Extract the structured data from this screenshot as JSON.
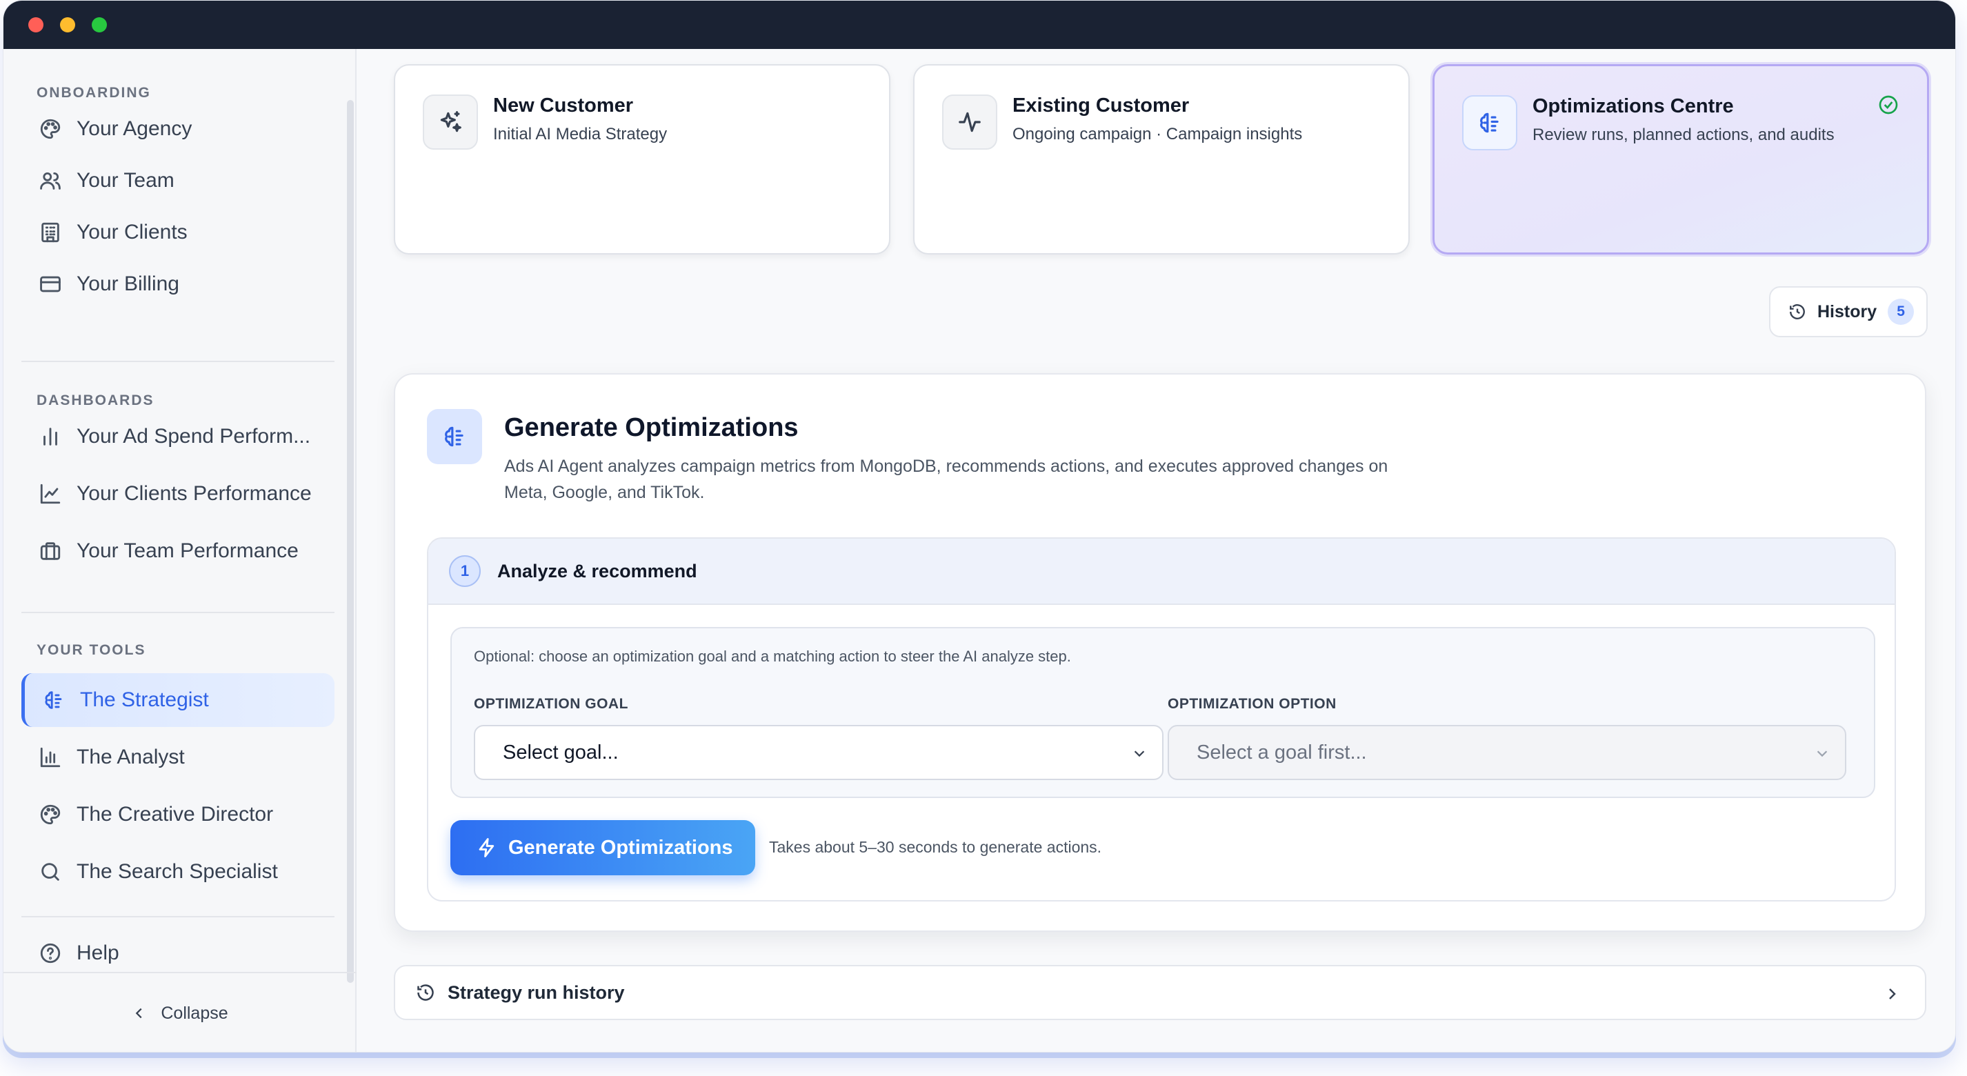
{
  "sidebar": {
    "sections": [
      {
        "label": "ONBOARDING"
      },
      {
        "label": "DASHBOARDS"
      },
      {
        "label": "YOUR TOOLS"
      }
    ],
    "items": [
      {
        "label": "Your Agency",
        "icon": "palette-icon"
      },
      {
        "label": "Your Team",
        "icon": "users-icon"
      },
      {
        "label": "Your Clients",
        "icon": "building-icon"
      },
      {
        "label": "Your Billing",
        "icon": "credit-card-icon"
      },
      {
        "label": "Your Ad Spend Perform...",
        "icon": "bar-chart-icon"
      },
      {
        "label": "Your Clients Performance",
        "icon": "line-chart-icon"
      },
      {
        "label": "Your Team Performance",
        "icon": "briefcase-icon"
      },
      {
        "label": "The Strategist",
        "icon": "brain-icon",
        "active": true
      },
      {
        "label": "The Analyst",
        "icon": "bar-chart-icon"
      },
      {
        "label": "The Creative Director",
        "icon": "palette-icon"
      },
      {
        "label": "The Search Specialist",
        "icon": "search-icon"
      },
      {
        "label": "Help",
        "icon": "help-circle-icon"
      }
    ],
    "collapse_label": "Collapse"
  },
  "cards": [
    {
      "title": "New Customer",
      "subtitle": "Initial AI Media Strategy",
      "icon": "sparkles-icon"
    },
    {
      "title": "Existing Customer",
      "subtitle": "Ongoing campaign · Campaign insights",
      "icon": "activity-icon"
    },
    {
      "title": "Optimizations Centre",
      "subtitle": "Review runs, planned actions, and audits",
      "icon": "brain-icon",
      "selected": true
    }
  ],
  "history": {
    "label": "History",
    "count": "5"
  },
  "panel": {
    "title": "Generate Optimizations",
    "description": "Ads AI Agent analyzes campaign metrics from MongoDB, recommends actions, and executes approved changes on Meta, Google, and TikTok.",
    "step": {
      "number": "1",
      "title": "Analyze & recommend",
      "hint": "Optional: choose an optimization goal and a matching action to steer the AI analyze step.",
      "goal_label": "OPTIMIZATION GOAL",
      "goal_value": "Select goal...",
      "option_label": "OPTIMIZATION OPTION",
      "option_value": "Select a goal first...",
      "button_label": "Generate Optimizations",
      "note": "Takes about 5–30 seconds to generate actions."
    }
  },
  "run_history_label": "Strategy run history",
  "colors": {
    "accent": "#2f62e6",
    "titlebar": "#1a2233",
    "selected_card_border": "#b5a9f3"
  }
}
